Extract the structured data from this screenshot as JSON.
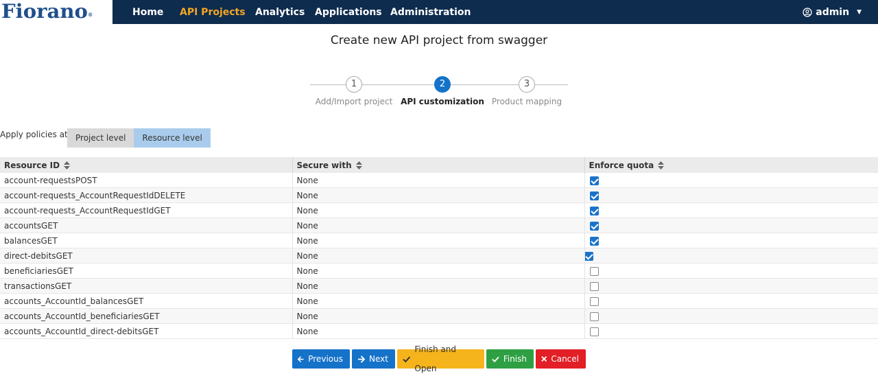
{
  "brand": {
    "logo_text": "Fiorano",
    "logo_mark": "®"
  },
  "nav": {
    "items": [
      {
        "label": "Home",
        "active": false
      },
      {
        "label": "API Projects",
        "active": true
      },
      {
        "label": "Analytics",
        "active": false
      },
      {
        "label": "Applications",
        "active": false
      },
      {
        "label": "Administration",
        "active": false
      }
    ],
    "user": {
      "label": "admin",
      "icon": "user-circle-icon"
    }
  },
  "page": {
    "title": "Create new API project from swagger"
  },
  "stepper": {
    "steps": [
      {
        "number": "1",
        "label": "Add/Import project",
        "active": false
      },
      {
        "number": "2",
        "label": "API customization",
        "active": true
      },
      {
        "number": "3",
        "label": "Product mapping",
        "active": false
      }
    ]
  },
  "policies": {
    "label": "Apply policies at",
    "options": [
      "Project level",
      "Resource level"
    ],
    "selected": "Resource level"
  },
  "table": {
    "columns": [
      "Resource ID",
      "Secure with",
      "Enforce quota"
    ],
    "rows": [
      {
        "resource": "account-requestsPOST",
        "secure": "None",
        "quota": true
      },
      {
        "resource": "account-requests_AccountRequestIdDELETE",
        "secure": "None",
        "quota": true
      },
      {
        "resource": "account-requests_AccountRequestIdGET",
        "secure": "None",
        "quota": true
      },
      {
        "resource": "accountsGET",
        "secure": "None",
        "quota": true
      },
      {
        "resource": "balancesGET",
        "secure": "None",
        "quota": true
      },
      {
        "resource": "direct-debitsGET",
        "secure": "None",
        "quota": true
      },
      {
        "resource": "beneficiariesGET",
        "secure": "None",
        "quota": false
      },
      {
        "resource": "transactionsGET",
        "secure": "None",
        "quota": false
      },
      {
        "resource": "accounts_AccountId_balancesGET",
        "secure": "None",
        "quota": false
      },
      {
        "resource": "accounts_AccountId_beneficiariesGET",
        "secure": "None",
        "quota": false
      },
      {
        "resource": "accounts_AccountId_direct-debitsGET",
        "secure": "None",
        "quota": false
      }
    ]
  },
  "actions": {
    "previous": "Previous",
    "next": "Next",
    "finish_open": "Finish and Open",
    "finish": "Finish",
    "cancel": "Cancel"
  },
  "colors": {
    "navbar": "#0e2c4e",
    "nav_active": "#f5a623",
    "primary": "#1572c9",
    "warning": "#f5b31c",
    "success": "#2ea043",
    "danger": "#e21e26",
    "selected_toggle": "#a9ccec"
  }
}
